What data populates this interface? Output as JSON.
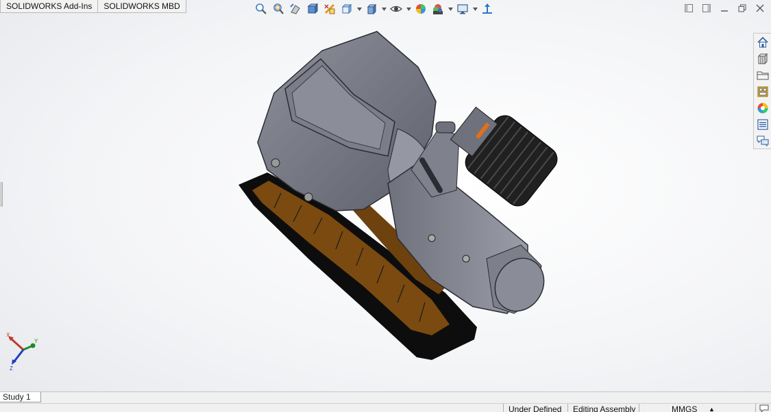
{
  "addin_tabs": [
    "SOLIDWORKS Add-Ins",
    "SOLIDWORKS MBD"
  ],
  "view_toolbar": {
    "icons": [
      "zoom-to-fit-icon",
      "zoom-to-area-icon",
      "previous-view-icon",
      "section-view-icon",
      "dynamic-annotation-icon",
      "view-orientation-icon",
      "display-style-icon",
      "hide-show-items-icon",
      "edit-appearance-icon",
      "apply-scene-icon",
      "view-settings-icon",
      "rotate-view-icon"
    ]
  },
  "window_controls": [
    "tile-left-icon",
    "tile-right-icon",
    "minimize-icon",
    "restore-icon",
    "close-icon"
  ],
  "task_pane": [
    "home-icon",
    "design-library-icon",
    "file-explorer-icon",
    "view-palette-icon",
    "appearances-icon",
    "custom-properties-icon",
    "forum-icon"
  ],
  "study_tab": "Study 1",
  "status": {
    "definition": "Under Defined",
    "mode": "Editing Assembly",
    "units": "MMGS"
  },
  "triad_labels": {
    "x": "X",
    "y": "Y",
    "z": "Z"
  },
  "colors": {
    "accent": "#1a6fbf",
    "model_gray": "#7a7c88",
    "pad_brown": "#7a4a10"
  }
}
